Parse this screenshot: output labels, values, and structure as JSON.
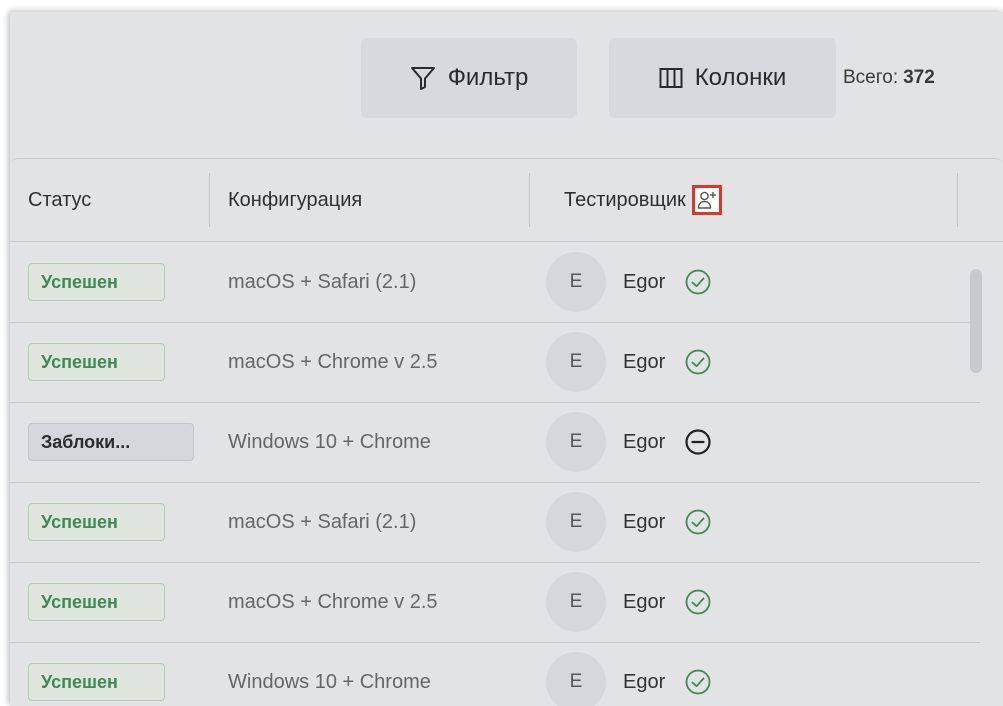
{
  "toolbar": {
    "filter_label": "Фильтр",
    "columns_label": "Колонки",
    "total_label": "Всего:",
    "total_value": "372"
  },
  "table": {
    "columns": {
      "status": "Статус",
      "configuration": "Конфигурация",
      "tester": "Тестировщик"
    },
    "rows": [
      {
        "status": "Успешен",
        "status_type": "success",
        "configuration": "macOS + Safari (2.1)",
        "avatar": "E",
        "tester": "Egor",
        "result_icon": "check-circle-icon"
      },
      {
        "status": "Успешен",
        "status_type": "success",
        "configuration": "macOS + Chrome v 2.5",
        "avatar": "E",
        "tester": "Egor",
        "result_icon": "check-circle-icon"
      },
      {
        "status": "Заблоки...",
        "status_type": "blocked",
        "configuration": "Windows 10 + Chrome",
        "avatar": "E",
        "tester": "Egor",
        "result_icon": "minus-circle-icon"
      },
      {
        "status": "Успешен",
        "status_type": "success",
        "configuration": "macOS + Safari (2.1)",
        "avatar": "E",
        "tester": "Egor",
        "result_icon": "check-circle-icon"
      },
      {
        "status": "Успешен",
        "status_type": "success",
        "configuration": "macOS + Chrome v 2.5",
        "avatar": "E",
        "tester": "Egor",
        "result_icon": "check-circle-icon"
      },
      {
        "status": "Успешен",
        "status_type": "success",
        "configuration": "Windows 10 + Chrome",
        "avatar": "E",
        "tester": "Egor",
        "result_icon": "check-circle-icon"
      }
    ]
  },
  "colors": {
    "success": "#3e8a52",
    "highlight": "#e0352b"
  }
}
